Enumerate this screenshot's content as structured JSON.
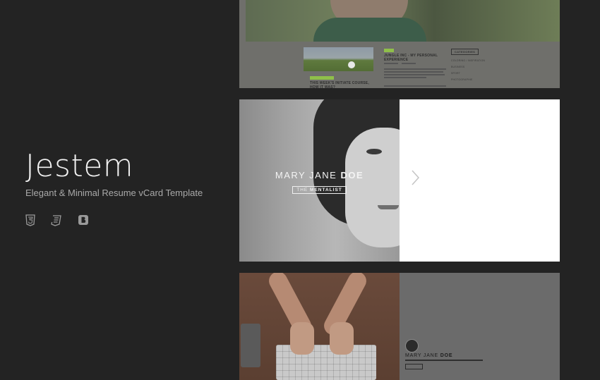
{
  "hero": {
    "title": "Jestem",
    "subtitle": "Elegant & Minimal Resume vCard Template",
    "icons": [
      "html5-icon",
      "css3-icon",
      "bootstrap-icon"
    ]
  },
  "top_card": {
    "post_main_title": "JUNGLE INC - MY PERSONAL EXPERIENCE",
    "post_second_title": "THIS WEEK'S INITIATE COURSE, HOW IT WAS?",
    "categories_label": "CATEGORIES",
    "categories": [
      "COLORING / INSPIRATION",
      "BUSINESS",
      "SPORT",
      "PHOTOGRAPHIE"
    ]
  },
  "mid_card": {
    "name_first": "MARY JANE",
    "name_last": "DOE",
    "role_prefix": "THE",
    "role_main": "MENTALIST"
  },
  "bottom_card": {
    "name_first": "MARY JANE",
    "name_last": "DOE"
  },
  "colors": {
    "background": "#232323",
    "accent_green": "#8fbf4a",
    "panel_white": "#ffffff"
  }
}
